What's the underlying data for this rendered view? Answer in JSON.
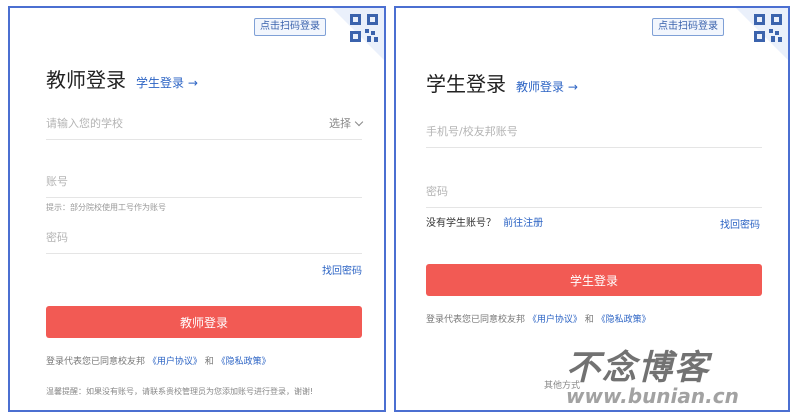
{
  "teacher": {
    "qr_tip": "点击扫码登录",
    "title": "教师登录",
    "switch_label": "学生登录 →",
    "school_placeholder": "请输入您的学校",
    "school_select_label": "选择",
    "account_placeholder": "账号",
    "account_hint": "提示：部分院校使用工号作为账号",
    "password_placeholder": "密码",
    "forgot_label": "找回密码",
    "login_label": "教师登录",
    "agree_prefix": "登录代表您已同意校友邦",
    "user_agreement": "《用户协议》",
    "agree_and": "和",
    "privacy_policy": "《隐私政策》",
    "tip_text": "温馨提醒：如果没有账号，请联系贵校管理员为您添加账号进行登录，谢谢!"
  },
  "student": {
    "qr_tip": "点击扫码登录",
    "title": "学生登录",
    "switch_label": "教师登录 →",
    "account_placeholder": "手机号/校友邦账号",
    "password_placeholder": "密码",
    "no_account_text": "没有学生账号？",
    "register_label": "前往注册",
    "forgot_label": "找回密码",
    "login_label": "学生登录",
    "agree_prefix": "登录代表您已同意校友邦",
    "user_agreement": "《用户协议》",
    "agree_and": "和",
    "privacy_policy": "《隐私政策》",
    "other_methods": "其他方式"
  },
  "watermark": {
    "brand": "不念博客",
    "url": "www.bunian.cn"
  },
  "colors": {
    "accent": "#2b63c4",
    "button": "#f25a54",
    "border": "#4b6fd1"
  }
}
